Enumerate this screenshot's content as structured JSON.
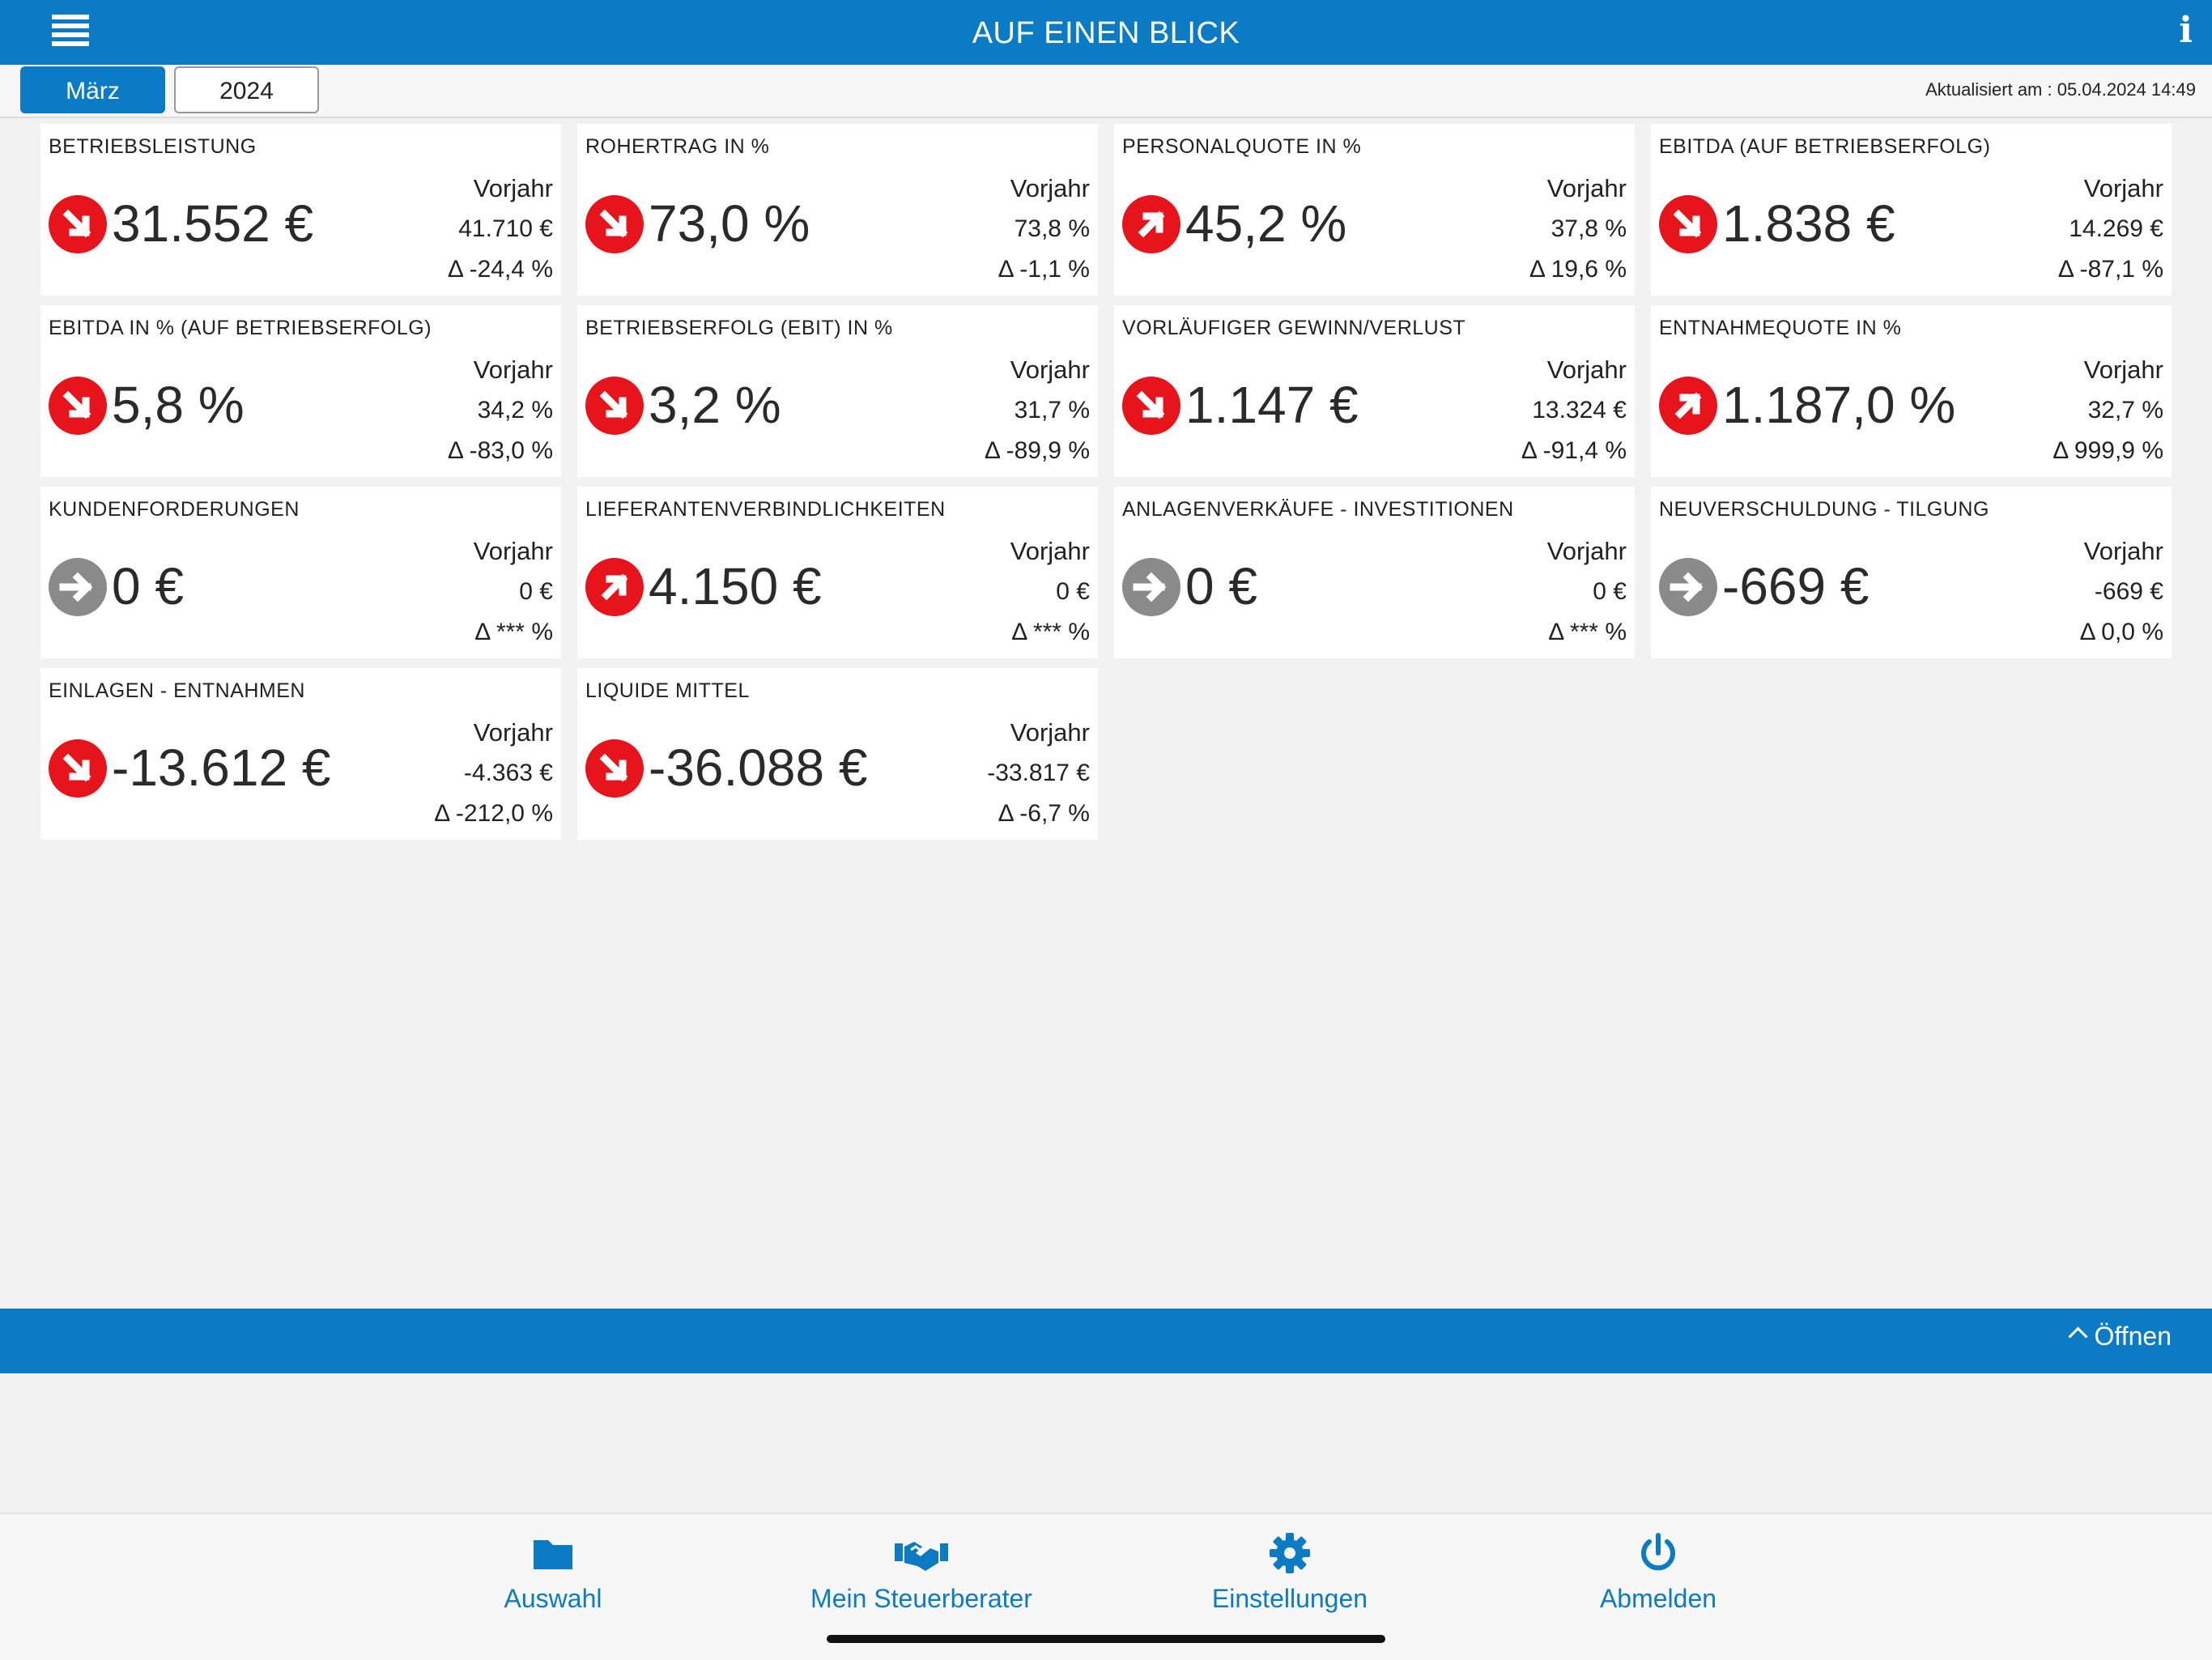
{
  "header": {
    "title": "AUF EINEN BLICK",
    "info_label": "i"
  },
  "period": {
    "month": "März",
    "year": "2024"
  },
  "updated": "Aktualisiert am : 05.04.2024 14:49",
  "colors": {
    "primary": "#0a7bc4",
    "trend_red": "#e8141c",
    "trend_neutral": "#8a8a8a"
  },
  "prev_year_label": "Vorjahr",
  "kpis": [
    {
      "label": "BETRIEBSLEISTUNG",
      "value": "31.552 €",
      "prev": "41.710 €",
      "delta": "Δ -24,4 %",
      "trend": "down",
      "icon": "arrow-down-right-icon"
    },
    {
      "label": "ROHERTRAG IN %",
      "value": "73,0 %",
      "prev": "73,8 %",
      "delta": "Δ -1,1 %",
      "trend": "down",
      "icon": "arrow-down-right-icon"
    },
    {
      "label": "PERSONALQUOTE IN %",
      "value": "45,2 %",
      "prev": "37,8 %",
      "delta": "Δ 19,6 %",
      "trend": "up",
      "icon": "arrow-up-right-icon"
    },
    {
      "label": "EBITDA (AUF BETRIEBSERFOLG)",
      "value": "1.838 €",
      "prev": "14.269 €",
      "delta": "Δ -87,1 %",
      "trend": "down",
      "icon": "arrow-down-right-icon"
    },
    {
      "label": "EBITDA IN % (AUF BETRIEBSERFOLG)",
      "value": "5,8 %",
      "prev": "34,2 %",
      "delta": "Δ -83,0 %",
      "trend": "down",
      "icon": "arrow-down-right-icon"
    },
    {
      "label": "BETRIEBSERFOLG (EBIT) IN %",
      "value": "3,2 %",
      "prev": "31,7 %",
      "delta": "Δ -89,9 %",
      "trend": "down",
      "icon": "arrow-down-right-icon"
    },
    {
      "label": "VORLÄUFIGER GEWINN/VERLUST",
      "value": "1.147 €",
      "prev": "13.324 €",
      "delta": "Δ -91,4 %",
      "trend": "down",
      "icon": "arrow-down-right-icon"
    },
    {
      "label": "ENTNAHMEQUOTE IN %",
      "value": "1.187,0 %",
      "prev": "32,7 %",
      "delta": "Δ 999,9 %",
      "trend": "up",
      "icon": "arrow-up-right-icon"
    },
    {
      "label": "KUNDENFORDERUNGEN",
      "value": "0 €",
      "prev": "0 €",
      "delta": "Δ *** %",
      "trend": "flat",
      "icon": "arrow-right-icon"
    },
    {
      "label": "LIEFERANTENVERBINDLICHKEITEN",
      "value": "4.150 €",
      "prev": "0 €",
      "delta": "Δ *** %",
      "trend": "up",
      "icon": "arrow-up-right-icon"
    },
    {
      "label": "ANLAGENVERKÄUFE - INVESTITIONEN",
      "value": "0 €",
      "prev": "0 €",
      "delta": "Δ *** %",
      "trend": "flat",
      "icon": "arrow-right-icon"
    },
    {
      "label": "NEUVERSCHULDUNG - TILGUNG",
      "value": "-669 €",
      "prev": "-669 €",
      "delta": "Δ 0,0 %",
      "trend": "flat",
      "icon": "arrow-right-icon"
    },
    {
      "label": "EINLAGEN - ENTNAHMEN",
      "value": "-13.612 €",
      "prev": "-4.363 €",
      "delta": "Δ -212,0 %",
      "trend": "down",
      "icon": "arrow-down-right-icon"
    },
    {
      "label": "LIQUIDE MITTEL",
      "value": "-36.088 €",
      "prev": "-33.817 €",
      "delta": "Δ -6,7 %",
      "trend": "down",
      "icon": "arrow-down-right-icon"
    }
  ],
  "drawer": {
    "open_label": "Öffnen"
  },
  "tabs": [
    {
      "label": "Auswahl",
      "icon": "folder-icon"
    },
    {
      "label": "Mein Steuerberater",
      "icon": "handshake-icon"
    },
    {
      "label": "Einstellungen",
      "icon": "gear-icon"
    },
    {
      "label": "Abmelden",
      "icon": "power-icon"
    }
  ]
}
